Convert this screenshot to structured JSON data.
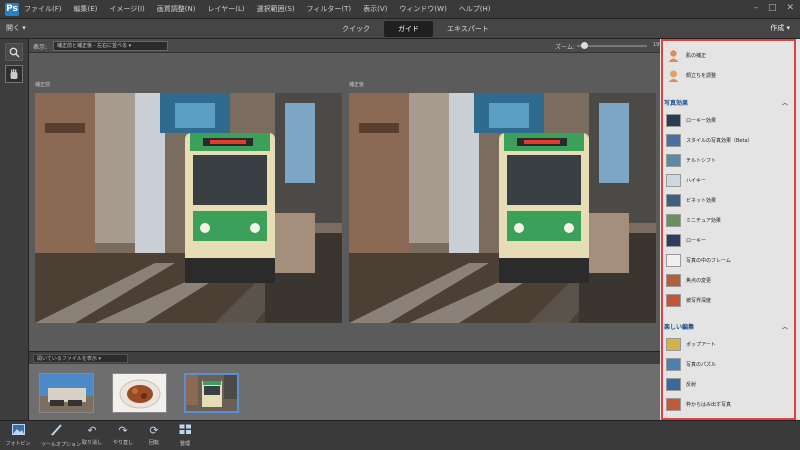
{
  "menubar": {
    "app_icon": "Ps",
    "items": [
      "ファイル(F)",
      "編集(E)",
      "イメージ(I)",
      "画質調整(N)",
      "レイヤー(L)",
      "選択範囲(S)",
      "フィルター(T)",
      "表示(V)",
      "ウィンドウ(W)",
      "ヘルプ(H)"
    ],
    "window_controls": [
      "–",
      "□",
      "✕"
    ]
  },
  "modebar": {
    "open_label": "開く",
    "tabs": [
      "クイック",
      "ガイド",
      "エキスパート"
    ],
    "active_tab": "ガイド",
    "create_label": "作成"
  },
  "toolstrip": {
    "tools": [
      "zoom-tool",
      "hand-tool"
    ]
  },
  "viewbar": {
    "view_label": "表示:",
    "view_value": "補正前と補正後 - 左右に並べる",
    "zoom_label": "ズーム:",
    "zoom_fraction": 0.1,
    "zoom_value": "19%"
  },
  "canvas": {
    "before_label": "補正前",
    "after_label": "補正後"
  },
  "filmbar": {
    "select_value": "開いているファイルを表示"
  },
  "filmstrip": {
    "thumbs": [
      "building",
      "food",
      "tram"
    ],
    "selected_index": 2
  },
  "bottombar": {
    "buttons": [
      {
        "label": "フォトビン",
        "icon": "photo-bin-icon"
      },
      {
        "label": "ツールオプション",
        "icon": "tool-options-icon"
      },
      {
        "label": "取り消し",
        "icon": "undo-icon"
      },
      {
        "label": "やり直し",
        "icon": "redo-icon"
      },
      {
        "label": "回転",
        "icon": "rotate-icon"
      },
      {
        "label": "整理",
        "icon": "organizer-icon"
      }
    ]
  },
  "rpanel": {
    "top_items": [
      {
        "label": "肌の補正",
        "icon": "person-icon"
      },
      {
        "label": "顔立ちを調整",
        "icon": "face-icon"
      }
    ],
    "section1": "写真効果",
    "section1_items": [
      {
        "label": "ローキー効果",
        "icon": "lowkey-icon"
      },
      {
        "label": "スタイルの写真効果（Beta）",
        "icon": "style-icon"
      },
      {
        "label": "チルトシフト",
        "icon": "tiltshift-icon"
      },
      {
        "label": "ハイキー",
        "icon": "highkey-icon"
      },
      {
        "label": "ビネット効果",
        "icon": "vignette-icon"
      },
      {
        "label": "ミニチュア効果",
        "icon": "miniature-icon"
      },
      {
        "label": "ローキー",
        "icon": "lowkey2-icon"
      },
      {
        "label": "写真の中のフレーム",
        "icon": "frame-icon"
      },
      {
        "label": "焦点の変更",
        "icon": "focus-icon"
      },
      {
        "label": "被写界深度",
        "icon": "dof-icon"
      }
    ],
    "section2": "楽しい編集",
    "section2_items": [
      {
        "label": "ポップアート",
        "icon": "popart-icon"
      },
      {
        "label": "写真のパズル",
        "icon": "puzzle-icon"
      },
      {
        "label": "反射",
        "icon": "reflection-icon"
      },
      {
        "label": "枠からはみ出す写真",
        "icon": "outofbounds-icon"
      }
    ]
  }
}
